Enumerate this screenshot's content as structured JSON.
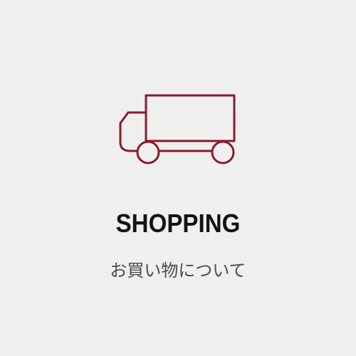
{
  "card": {
    "title": "SHOPPING",
    "subtitle": "お買い物について",
    "icon": "truck-icon",
    "colors": {
      "background": "#efeff0",
      "icon_stroke": "#8b1a2b",
      "title": "#141414",
      "subtitle": "#4a4a4a"
    }
  }
}
